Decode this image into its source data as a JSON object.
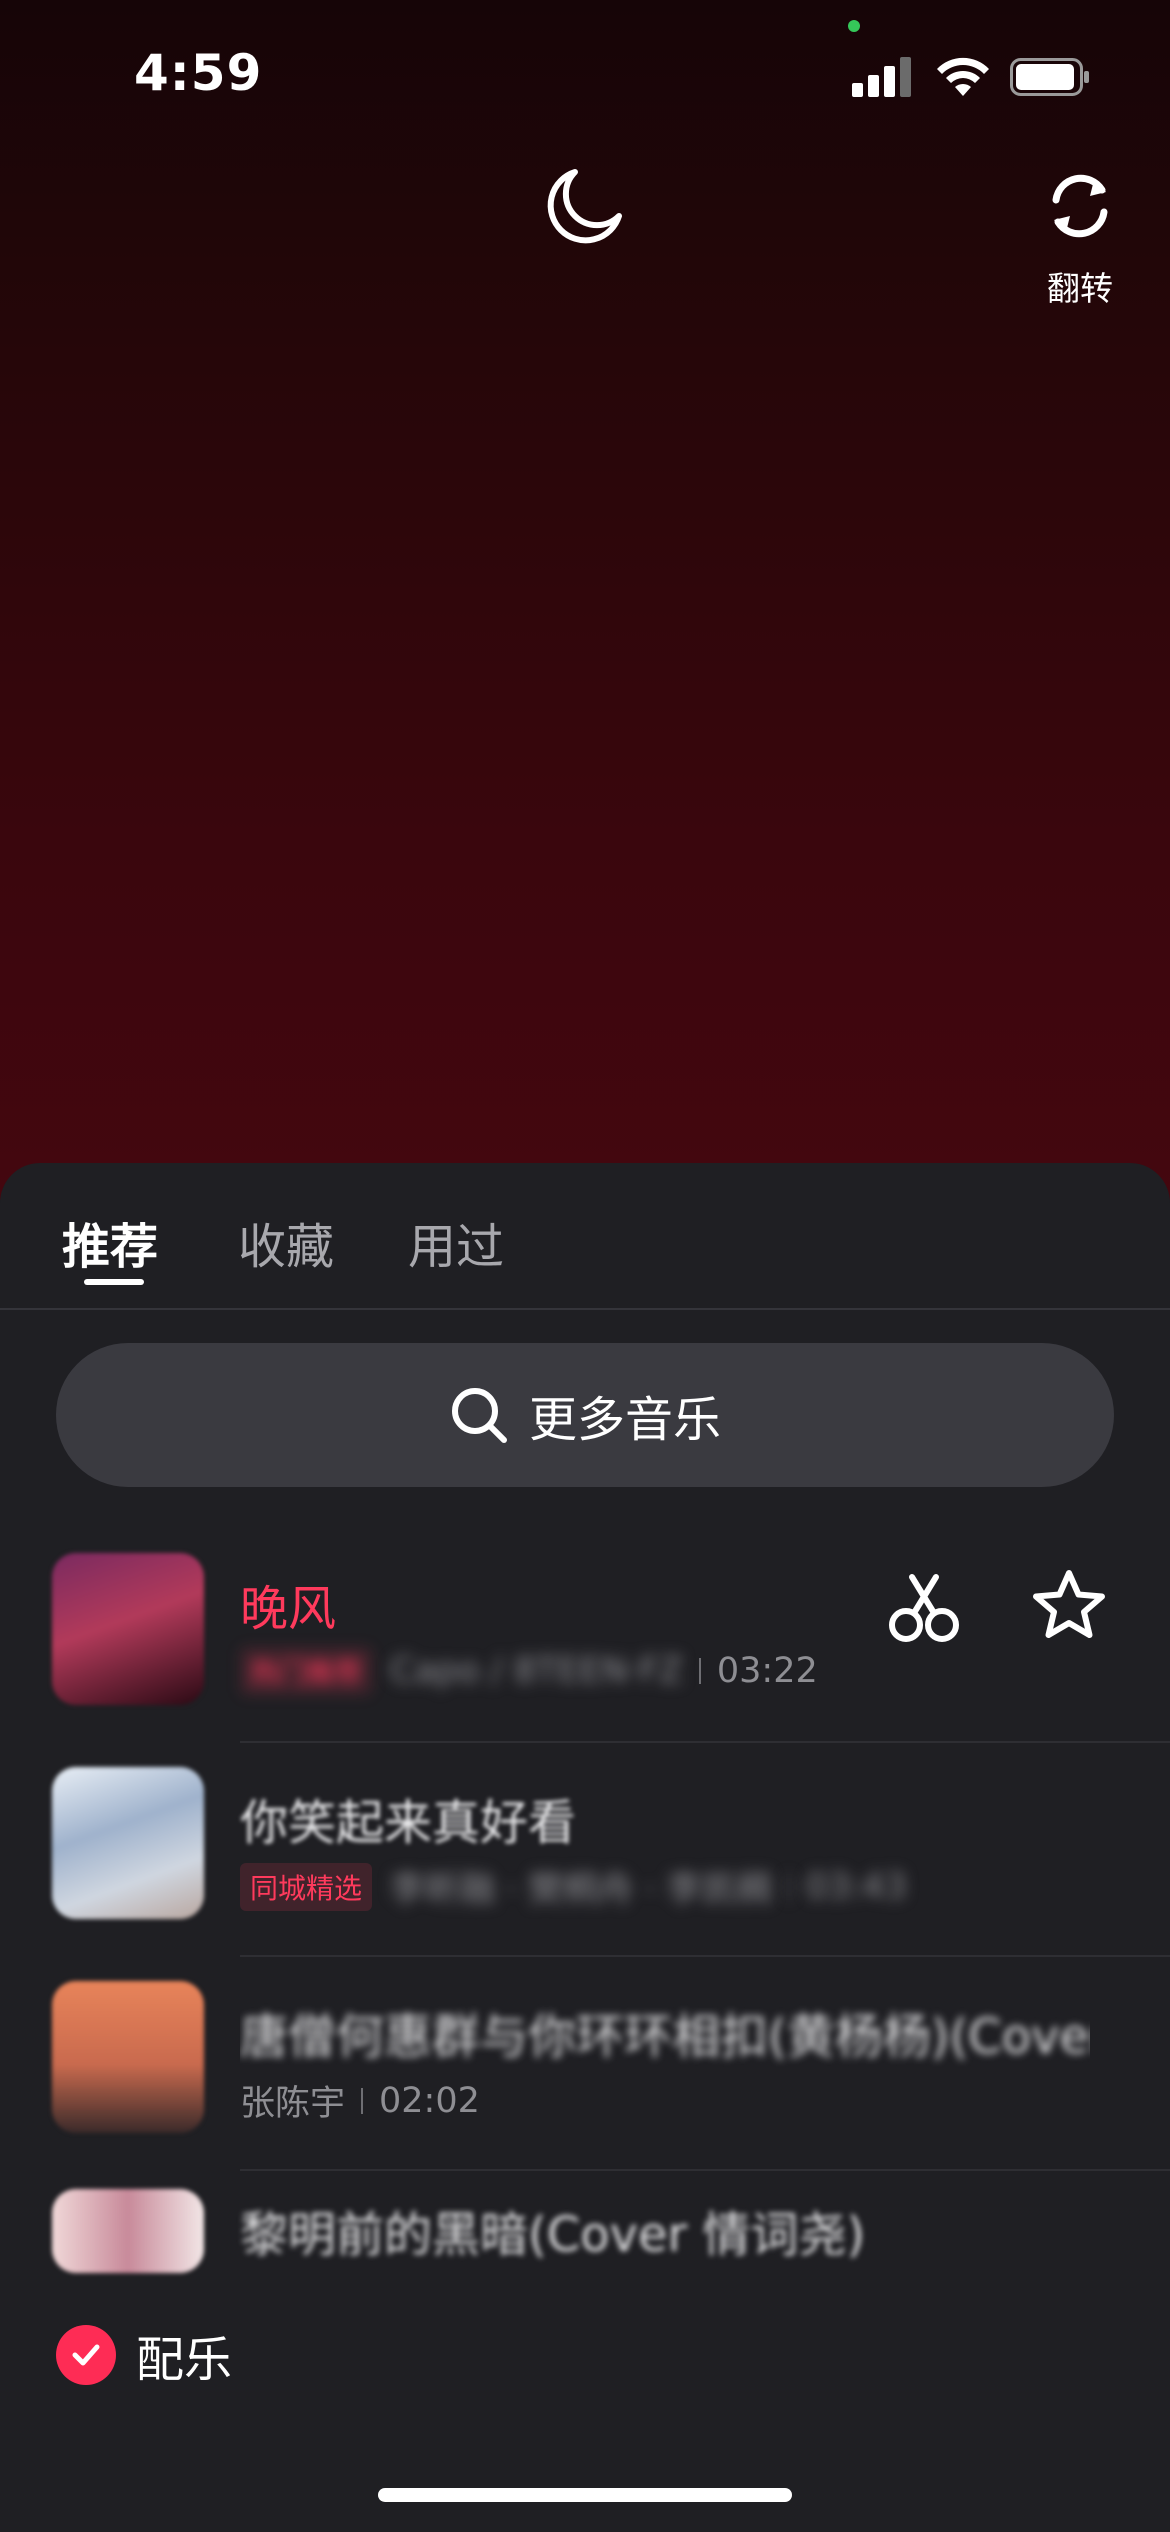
{
  "status_bar": {
    "time": "4:59"
  },
  "camera": {
    "flip_label": "翻转"
  },
  "tabs": [
    {
      "label": "推荐"
    },
    {
      "label": "收藏"
    },
    {
      "label": "用过"
    }
  ],
  "search": {
    "label": "更多音乐"
  },
  "songs": [
    {
      "title": "晚风",
      "tag": "热门推荐",
      "artist": "Capo / 8TEEN·FZ",
      "duration": "03:22"
    },
    {
      "title": "你笑起来真好看",
      "tag": "同城精选",
      "artist": "李昕融 · 樊桐舟 · 李凯稠",
      "duration": "03:43"
    },
    {
      "title": "唐僧何惠群与你环环相扣(黄杨杨)(Cover...",
      "artist": "张陈宇",
      "duration": "02:02"
    },
    {
      "title": "黎明前的黑暗(Cover 情词尧)"
    }
  ],
  "music_toggle": {
    "label": "配乐",
    "checked": true
  },
  "colors": {
    "accent": "#fe2c55",
    "sheet": "#1f1f23"
  }
}
